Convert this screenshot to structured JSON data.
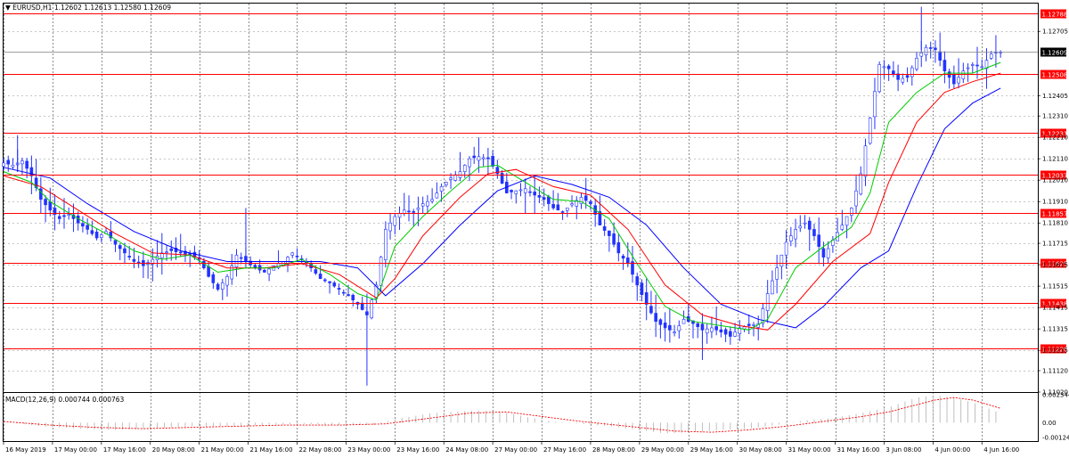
{
  "header": {
    "symbol_label": "EURUSD,H1",
    "ohlc": "1.12602 1.12613 1.12580 1.12609"
  },
  "macd_header": {
    "label": "MACD(12,26,9)",
    "values": "0.000744 0.000763"
  },
  "colors": {
    "candles": "#2233ff",
    "level_lines": "#ff0000",
    "ma_fast": "#00cc00",
    "ma_mid": "#ff0000",
    "ma_slow": "#0000ff",
    "macd_hist": "#b0b0b0",
    "macd_signal": "#ff0000",
    "current_price_tag": "#000000"
  },
  "chart_data": [
    {
      "type": "candlestick",
      "symbol": "EURUSD",
      "timeframe": "H1",
      "ylim": [
        1.1102,
        1.12835
      ],
      "price_axis_ticks": [
        "1.12705",
        "1.12405",
        "1.12310",
        "1.12210",
        "1.12110",
        "1.12010",
        "1.11910",
        "1.11810",
        "1.11715",
        "1.11615",
        "1.11515",
        "1.11415",
        "1.11315",
        "1.11215",
        "1.11120",
        "1.11020"
      ],
      "time_axis_labels": [
        "16 May 2019",
        "17 May 00:00",
        "17 May 16:00",
        "20 May 08:00",
        "21 May 00:00",
        "21 May 16:00",
        "22 May 08:00",
        "23 May 00:00",
        "23 May 16:00",
        "24 May 08:00",
        "27 May 00:00",
        "27 May 16:00",
        "28 May 08:00",
        "29 May 00:00",
        "29 May 16:00",
        "30 May 08:00",
        "31 May 00:00",
        "31 May 16:00",
        "3 Jun 08:00",
        "4 Jun 00:00",
        "4 Jun 16:00"
      ],
      "level_lines": [
        "1.12788",
        "1.12508",
        "1.12231",
        "1.12037",
        "1.11857",
        "1.11625",
        "1.11438",
        "1.11226"
      ],
      "current_price": "1.12609",
      "close_path": [
        [
          0,
          1.1209
        ],
        [
          2,
          1.1208
        ],
        [
          4,
          1.121
        ],
        [
          6,
          1.1203
        ],
        [
          8,
          1.1192
        ],
        [
          10,
          1.1187
        ],
        [
          12,
          1.1183
        ],
        [
          14,
          1.1185
        ],
        [
          16,
          1.1181
        ],
        [
          18,
          1.1178
        ],
        [
          20,
          1.1174
        ],
        [
          22,
          1.1177
        ],
        [
          24,
          1.1171
        ],
        [
          26,
          1.1167
        ],
        [
          28,
          1.1163
        ],
        [
          30,
          1.1161
        ],
        [
          32,
          1.1164
        ],
        [
          34,
          1.1167
        ],
        [
          36,
          1.1168
        ],
        [
          38,
          1.1167
        ],
        [
          40,
          1.1166
        ],
        [
          42,
          1.1164
        ],
        [
          44,
          1.1156
        ],
        [
          46,
          1.115
        ],
        [
          48,
          1.1156
        ],
        [
          50,
          1.1166
        ],
        [
          52,
          1.1163
        ],
        [
          54,
          1.116
        ],
        [
          56,
          1.1158
        ],
        [
          58,
          1.1161
        ],
        [
          60,
          1.1163
        ],
        [
          62,
          1.1167
        ],
        [
          64,
          1.1164
        ],
        [
          66,
          1.116
        ],
        [
          68,
          1.1155
        ],
        [
          70,
          1.1153
        ],
        [
          72,
          1.115
        ],
        [
          74,
          1.1147
        ],
        [
          76,
          1.1143
        ],
        [
          78,
          1.1138
        ],
        [
          80,
          1.1152
        ],
        [
          82,
          1.1178
        ],
        [
          84,
          1.1184
        ],
        [
          86,
          1.1187
        ],
        [
          88,
          1.1186
        ],
        [
          90,
          1.119
        ],
        [
          92,
          1.1192
        ],
        [
          94,
          1.1198
        ],
        [
          96,
          1.1202
        ],
        [
          98,
          1.1205
        ],
        [
          100,
          1.1211
        ],
        [
          102,
          1.1212
        ],
        [
          104,
          1.1211
        ],
        [
          106,
          1.1204
        ],
        [
          108,
          1.1195
        ],
        [
          110,
          1.1196
        ],
        [
          112,
          1.1197
        ],
        [
          114,
          1.1194
        ],
        [
          116,
          1.1192
        ],
        [
          118,
          1.1188
        ],
        [
          120,
          1.1186
        ],
        [
          122,
          1.119
        ],
        [
          124,
          1.1193
        ],
        [
          126,
          1.119
        ],
        [
          128,
          1.118
        ],
        [
          130,
          1.1175
        ],
        [
          132,
          1.1167
        ],
        [
          134,
          1.1162
        ],
        [
          136,
          1.1152
        ],
        [
          138,
          1.1143
        ],
        [
          140,
          1.1135
        ],
        [
          142,
          1.1132
        ],
        [
          144,
          1.113
        ],
        [
          146,
          1.1136
        ],
        [
          148,
          1.1134
        ],
        [
          150,
          1.1131
        ],
        [
          152,
          1.1132
        ],
        [
          154,
          1.113
        ],
        [
          156,
          1.1128
        ],
        [
          158,
          1.1132
        ],
        [
          160,
          1.1133
        ],
        [
          162,
          1.1134
        ],
        [
          164,
          1.1148
        ],
        [
          166,
          1.116
        ],
        [
          168,
          1.1172
        ],
        [
          170,
          1.1178
        ],
        [
          172,
          1.1181
        ],
        [
          174,
          1.1175
        ],
        [
          176,
          1.1165
        ],
        [
          178,
          1.1173
        ],
        [
          180,
          1.118
        ],
        [
          182,
          1.1188
        ],
        [
          184,
          1.1204
        ],
        [
          186,
          1.123
        ],
        [
          188,
          1.1255
        ],
        [
          190,
          1.1253
        ],
        [
          192,
          1.1248
        ],
        [
          194,
          1.1249
        ],
        [
          196,
          1.1258
        ],
        [
          198,
          1.1263
        ],
        [
          200,
          1.1262
        ],
        [
          202,
          1.1252
        ],
        [
          204,
          1.1246
        ],
        [
          206,
          1.1252
        ],
        [
          208,
          1.1255
        ],
        [
          210,
          1.1254
        ],
        [
          212,
          1.126
        ],
        [
          214,
          1.12609
        ]
      ],
      "ma_fast_path": [
        [
          0,
          1.1205
        ],
        [
          6,
          1.12
        ],
        [
          10,
          1.1191
        ],
        [
          16,
          1.1183
        ],
        [
          22,
          1.1176
        ],
        [
          28,
          1.1168
        ],
        [
          34,
          1.1164
        ],
        [
          40,
          1.1166
        ],
        [
          46,
          1.1158
        ],
        [
          52,
          1.116
        ],
        [
          58,
          1.116
        ],
        [
          64,
          1.1164
        ],
        [
          70,
          1.1157
        ],
        [
          76,
          1.1148
        ],
        [
          80,
          1.1145
        ],
        [
          84,
          1.117
        ],
        [
          90,
          1.1184
        ],
        [
          96,
          1.1196
        ],
        [
          102,
          1.1207
        ],
        [
          106,
          1.1208
        ],
        [
          112,
          1.12
        ],
        [
          118,
          1.1192
        ],
        [
          124,
          1.1191
        ],
        [
          130,
          1.1183
        ],
        [
          136,
          1.1162
        ],
        [
          142,
          1.1142
        ],
        [
          148,
          1.1135
        ],
        [
          154,
          1.1133
        ],
        [
          160,
          1.1131
        ],
        [
          164,
          1.1136
        ],
        [
          170,
          1.116
        ],
        [
          176,
          1.117
        ],
        [
          182,
          1.1179
        ],
        [
          186,
          1.1195
        ],
        [
          190,
          1.1228
        ],
        [
          196,
          1.1242
        ],
        [
          202,
          1.1251
        ],
        [
          208,
          1.1251
        ],
        [
          214,
          1.1256
        ]
      ],
      "ma_mid_path": [
        [
          0,
          1.1203
        ],
        [
          8,
          1.1198
        ],
        [
          16,
          1.1187
        ],
        [
          24,
          1.1176
        ],
        [
          32,
          1.1167
        ],
        [
          40,
          1.1166
        ],
        [
          48,
          1.116
        ],
        [
          56,
          1.116
        ],
        [
          64,
          1.1162
        ],
        [
          72,
          1.1157
        ],
        [
          80,
          1.1146
        ],
        [
          84,
          1.1155
        ],
        [
          90,
          1.1175
        ],
        [
          98,
          1.1193
        ],
        [
          104,
          1.1204
        ],
        [
          110,
          1.1206
        ],
        [
          118,
          1.1198
        ],
        [
          126,
          1.1194
        ],
        [
          134,
          1.1178
        ],
        [
          142,
          1.1152
        ],
        [
          150,
          1.1138
        ],
        [
          158,
          1.1133
        ],
        [
          164,
          1.1131
        ],
        [
          170,
          1.1143
        ],
        [
          178,
          1.1163
        ],
        [
          186,
          1.1176
        ],
        [
          190,
          1.12
        ],
        [
          196,
          1.1228
        ],
        [
          202,
          1.1242
        ],
        [
          208,
          1.1247
        ],
        [
          214,
          1.1251
        ]
      ],
      "ma_slow_path": [
        [
          0,
          1.1207
        ],
        [
          10,
          1.1202
        ],
        [
          18,
          1.119
        ],
        [
          28,
          1.1177
        ],
        [
          38,
          1.1168
        ],
        [
          48,
          1.1163
        ],
        [
          58,
          1.1163
        ],
        [
          68,
          1.1163
        ],
        [
          76,
          1.116
        ],
        [
          82,
          1.1147
        ],
        [
          90,
          1.1162
        ],
        [
          98,
          1.118
        ],
        [
          106,
          1.1196
        ],
        [
          114,
          1.1203
        ],
        [
          122,
          1.1199
        ],
        [
          130,
          1.1193
        ],
        [
          138,
          1.118
        ],
        [
          146,
          1.116
        ],
        [
          154,
          1.1143
        ],
        [
          162,
          1.1136
        ],
        [
          170,
          1.1132
        ],
        [
          176,
          1.1142
        ],
        [
          184,
          1.116
        ],
        [
          190,
          1.1168
        ],
        [
          196,
          1.1198
        ],
        [
          202,
          1.1225
        ],
        [
          208,
          1.1237
        ],
        [
          214,
          1.1244
        ]
      ]
    },
    {
      "type": "macd",
      "params": "12,26,9",
      "ylim": [
        -0.00124,
        0.00234
      ],
      "axis_ticks": [
        "0.002344",
        "0.00",
        "-0.00124"
      ],
      "histogram_path": [
        [
          0,
          0.0001
        ],
        [
          8,
          -0.0003
        ],
        [
          16,
          -0.0005
        ],
        [
          24,
          -0.0006
        ],
        [
          32,
          -0.0005
        ],
        [
          40,
          -0.0003
        ],
        [
          48,
          -0.0003
        ],
        [
          56,
          -0.0002
        ],
        [
          64,
          -0.0001
        ],
        [
          72,
          -0.0002
        ],
        [
          80,
          -0.0002
        ],
        [
          84,
          0.0003
        ],
        [
          92,
          0.0008
        ],
        [
          100,
          0.001
        ],
        [
          106,
          0.001
        ],
        [
          112,
          0.0005
        ],
        [
          118,
          0.0001
        ],
        [
          124,
          -0.0001
        ],
        [
          130,
          -0.0003
        ],
        [
          136,
          -0.0006
        ],
        [
          142,
          -0.0009
        ],
        [
          148,
          -0.0008
        ],
        [
          154,
          -0.0006
        ],
        [
          160,
          -0.0005
        ],
        [
          166,
          -0.0002
        ],
        [
          172,
          0.0002
        ],
        [
          178,
          0.0004
        ],
        [
          184,
          0.0008
        ],
        [
          190,
          0.0013
        ],
        [
          196,
          0.0021
        ],
        [
          200,
          0.0023
        ],
        [
          204,
          0.0021
        ],
        [
          208,
          0.0017
        ],
        [
          214,
          0.0008
        ]
      ],
      "signal_path": [
        [
          0,
          0.0001
        ],
        [
          10,
          -0.0002
        ],
        [
          20,
          -0.0004
        ],
        [
          30,
          -0.0005
        ],
        [
          40,
          -0.0004
        ],
        [
          50,
          -0.0003
        ],
        [
          60,
          -0.0002
        ],
        [
          72,
          -0.0002
        ],
        [
          82,
          -0.0001
        ],
        [
          92,
          0.0004
        ],
        [
          100,
          0.0008
        ],
        [
          108,
          0.0009
        ],
        [
          116,
          0.0005
        ],
        [
          124,
          0.0001
        ],
        [
          134,
          -0.0003
        ],
        [
          144,
          -0.0007
        ],
        [
          152,
          -0.0008
        ],
        [
          160,
          -0.0006
        ],
        [
          168,
          -0.0003
        ],
        [
          176,
          0.0001
        ],
        [
          184,
          0.0005
        ],
        [
          190,
          0.0009
        ],
        [
          196,
          0.0015
        ],
        [
          200,
          0.0019
        ],
        [
          204,
          0.0021
        ],
        [
          208,
          0.0019
        ],
        [
          214,
          0.0012
        ]
      ]
    }
  ]
}
